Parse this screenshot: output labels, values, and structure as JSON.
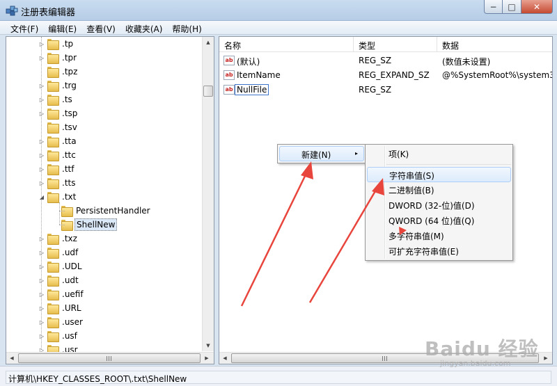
{
  "window": {
    "title": "注册表编辑器",
    "controls": {
      "minimize": "−",
      "maximize": "□",
      "close": "✕"
    }
  },
  "menubar": {
    "items": [
      "文件(F)",
      "编辑(E)",
      "查看(V)",
      "收藏夹(A)",
      "帮助(H)"
    ]
  },
  "tree": {
    "items": [
      {
        "label": ".tp",
        "expander": "▷"
      },
      {
        "label": ".tpr",
        "expander": "▷"
      },
      {
        "label": ".tpz",
        "expander": ""
      },
      {
        "label": ".trg",
        "expander": "▷"
      },
      {
        "label": ".ts",
        "expander": "▷"
      },
      {
        "label": ".tsp",
        "expander": "▷"
      },
      {
        "label": ".tsv",
        "expander": ""
      },
      {
        "label": ".tta",
        "expander": "▷"
      },
      {
        "label": ".ttc",
        "expander": "▷"
      },
      {
        "label": ".ttf",
        "expander": "▷"
      },
      {
        "label": ".tts",
        "expander": "▷"
      },
      {
        "label": ".txt",
        "expander": "◢"
      },
      {
        "label": "PersistentHandler",
        "expander": ""
      },
      {
        "label": "ShellNew",
        "expander": ""
      },
      {
        "label": ".txz",
        "expander": "▷"
      },
      {
        "label": ".udf",
        "expander": "▷"
      },
      {
        "label": ".UDL",
        "expander": "▷"
      },
      {
        "label": ".udt",
        "expander": "▷"
      },
      {
        "label": ".uefif",
        "expander": "▷"
      },
      {
        "label": ".URL",
        "expander": "▷"
      },
      {
        "label": ".user",
        "expander": "▷"
      },
      {
        "label": ".usf",
        "expander": "▷"
      },
      {
        "label": ".usr",
        "expander": "▷"
      }
    ],
    "selected": "ShellNew"
  },
  "list": {
    "columns": [
      "名称",
      "类型",
      "数据"
    ],
    "rows": [
      {
        "icon": "ab",
        "name": "(默认)",
        "type": "REG_SZ",
        "data": "(数值未设置)"
      },
      {
        "icon": "ab",
        "name": "ItemName",
        "type": "REG_EXPAND_SZ",
        "data": "@%SystemRoot%\\system3"
      },
      {
        "icon": "ab",
        "name": "NullFile",
        "type": "REG_SZ",
        "data": ""
      }
    ]
  },
  "context_menu": {
    "new_label": "新建(N)",
    "submenu_arrow": "▸"
  },
  "submenu": {
    "items": [
      "项(K)",
      "字符串值(S)",
      "二进制值(B)",
      "DWORD (32-位)值(D)",
      "QWORD (64 位)值(Q)",
      "多字符串值(M)",
      "可扩充字符串值(E)"
    ],
    "highlighted": "字符串值(S)"
  },
  "statusbar": {
    "path": "计算机\\HKEY_CLASSES_ROOT\\.txt\\ShellNew"
  },
  "scroll_arrows": {
    "up": "▲",
    "down": "▼",
    "left": "◀",
    "right": "▶"
  },
  "watermark": {
    "main": "Baidu 经验",
    "sub": "jingyan.baidu.com"
  },
  "colors": {
    "annotation_arrow": "#e8453c",
    "selection": "#dbe8f8",
    "menu_highlight": "#dcebfc"
  }
}
